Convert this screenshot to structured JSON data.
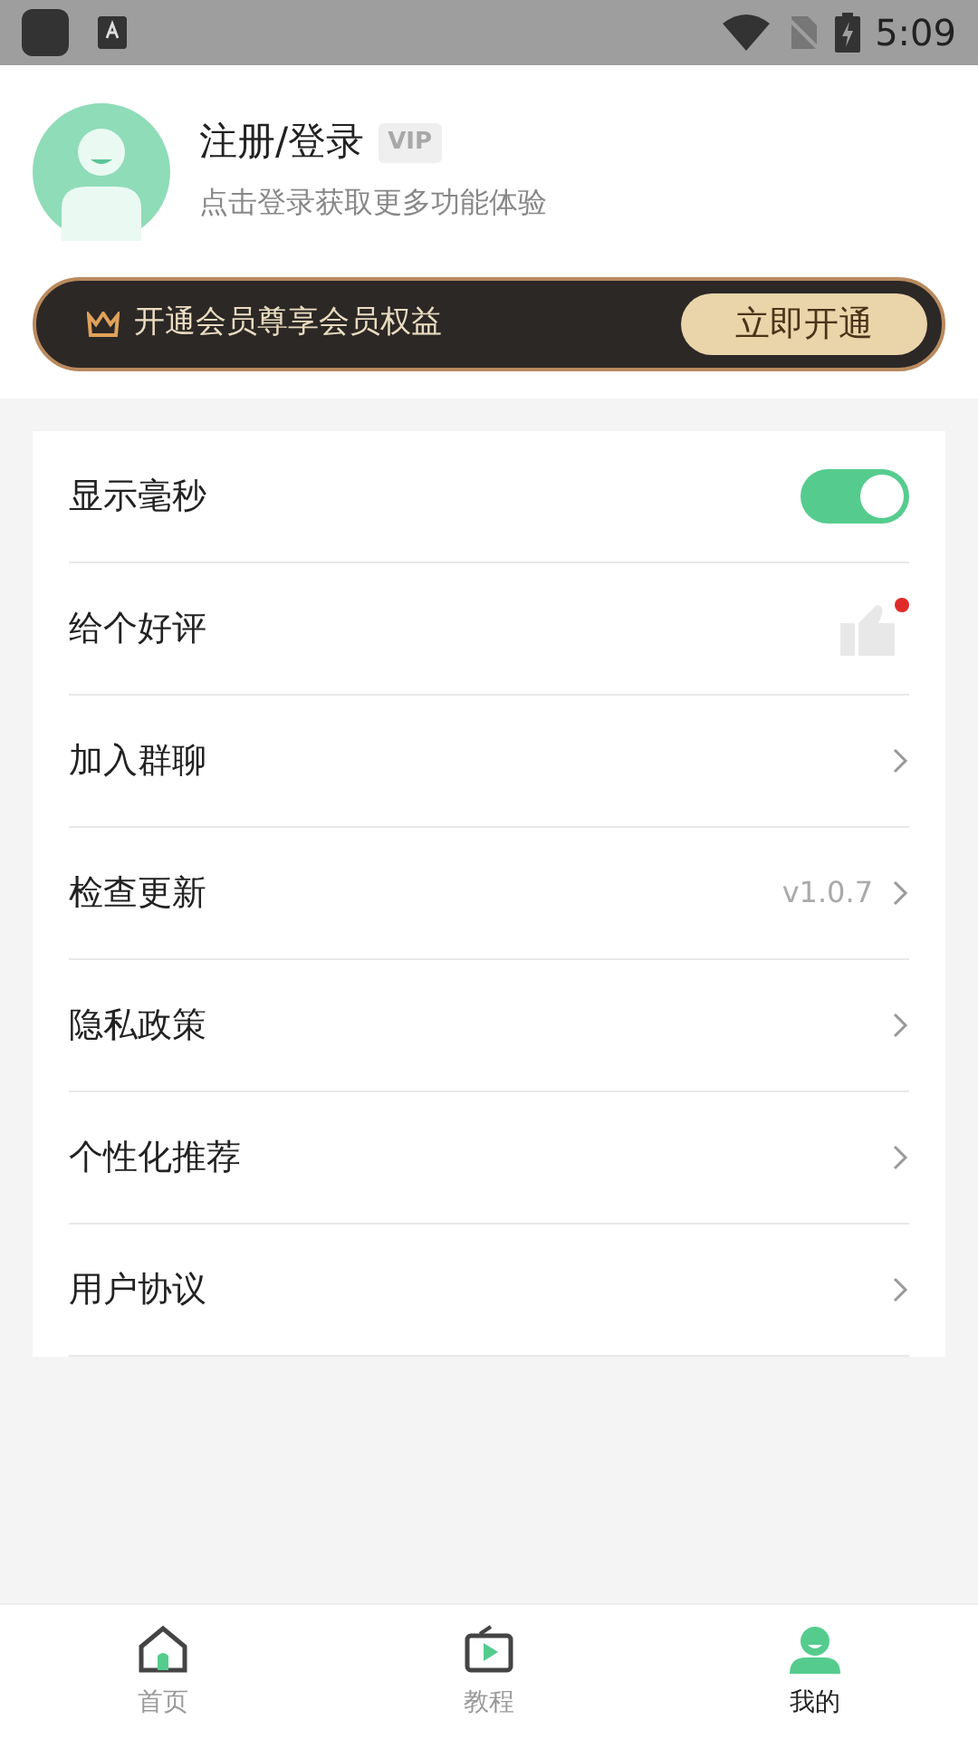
{
  "status_bar": {
    "time": "5:09"
  },
  "profile": {
    "title": "注册/登录",
    "vip": "VIP",
    "subtitle": "点击登录获取更多功能体验"
  },
  "vip_banner": {
    "text": "开通会员尊享会员权益",
    "button": "立即开通"
  },
  "settings": [
    {
      "kind": "toggle",
      "label": "显示毫秒",
      "on": true
    },
    {
      "kind": "thumb",
      "label": "给个好评",
      "badge": true
    },
    {
      "kind": "link",
      "label": "加入群聊"
    },
    {
      "kind": "link",
      "label": "检查更新",
      "value": "v1.0.7"
    },
    {
      "kind": "link",
      "label": "隐私政策"
    },
    {
      "kind": "link",
      "label": "个性化推荐"
    },
    {
      "kind": "link",
      "label": "用户协议"
    }
  ],
  "tabs": [
    {
      "kind": "home",
      "label": "首页",
      "selected": false
    },
    {
      "kind": "tutorial",
      "label": "教程",
      "selected": false
    },
    {
      "kind": "me",
      "label": "我的",
      "selected": true
    }
  ]
}
